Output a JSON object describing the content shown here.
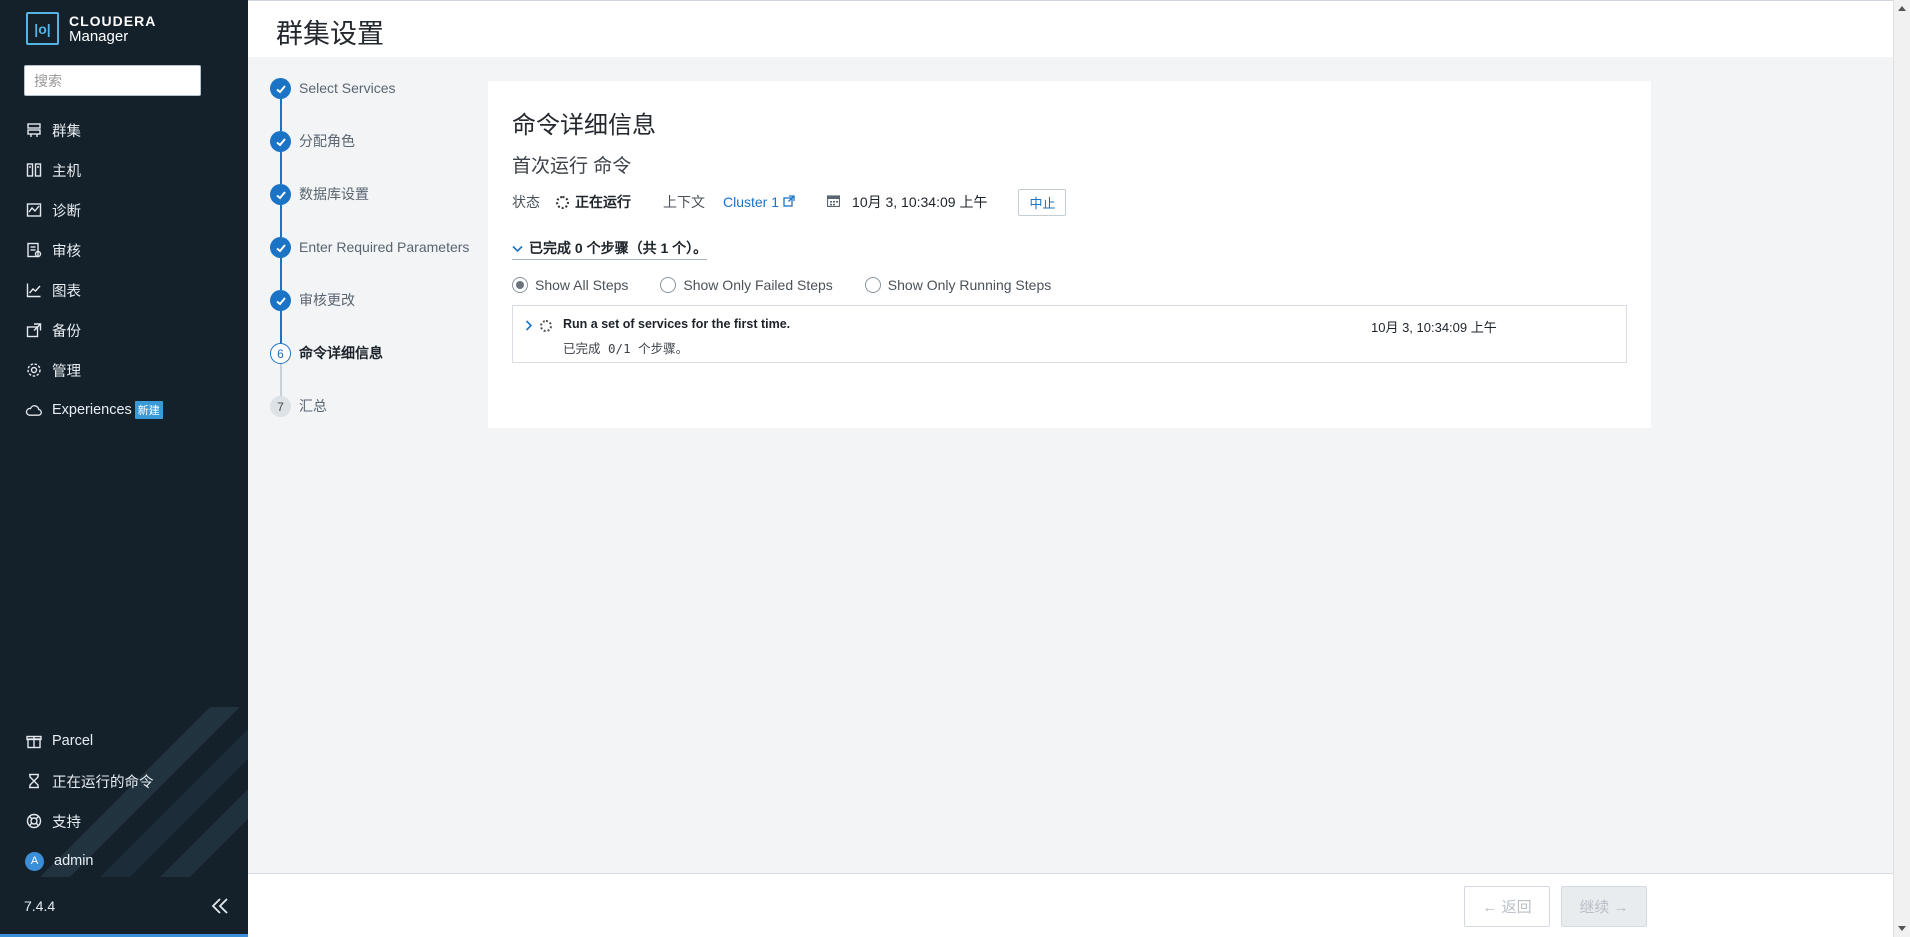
{
  "sidebar": {
    "brand": "CLOUDERA",
    "product": "Manager",
    "search_placeholder": "搜索",
    "nav_items": [
      {
        "label": "群集",
        "icon": "cluster-icon"
      },
      {
        "label": "主机",
        "icon": "host-icon"
      },
      {
        "label": "诊断",
        "icon": "diagnostics-icon"
      },
      {
        "label": "审核",
        "icon": "audit-icon"
      },
      {
        "label": "图表",
        "icon": "chart-icon"
      },
      {
        "label": "备份",
        "icon": "backup-icon"
      },
      {
        "label": "管理",
        "icon": "gear-icon"
      },
      {
        "label": "Experiences",
        "icon": "cloud-icon",
        "badge": "新建"
      }
    ],
    "bottom_items": [
      {
        "label": "Parcel",
        "icon": "parcel-icon"
      },
      {
        "label": "正在运行的命令",
        "icon": "hourglass-icon"
      },
      {
        "label": "支持",
        "icon": "lifebuoy-icon"
      },
      {
        "label": "admin",
        "icon": "avatar",
        "avatar_letter": "A"
      }
    ],
    "version": "7.4.4"
  },
  "header": {
    "title": "群集设置"
  },
  "wizard_steps": [
    {
      "label": "Select Services",
      "state": "done"
    },
    {
      "label": "分配角色",
      "state": "done"
    },
    {
      "label": "数据库设置",
      "state": "done"
    },
    {
      "label": "Enter Required Parameters",
      "state": "done"
    },
    {
      "label": "审核更改",
      "state": "done"
    },
    {
      "label": "命令详细信息",
      "state": "current",
      "number": "6"
    },
    {
      "label": "汇总",
      "state": "todo",
      "number": "7"
    }
  ],
  "command": {
    "title": "命令详细信息",
    "subtitle": "首次运行 命令",
    "status_label": "状态",
    "status_value": "正在运行",
    "context_label": "上下文",
    "context_link": "Cluster 1",
    "timestamp": "10月 3, 10:34:09 上午",
    "abort_label": "中止",
    "summary": "已完成 0 个步骤（共 1 个）。",
    "filters": [
      {
        "label": "Show All Steps",
        "selected": true
      },
      {
        "label": "Show Only Failed Steps",
        "selected": false
      },
      {
        "label": "Show Only Running Steps",
        "selected": false
      }
    ],
    "steps": [
      {
        "title": "Run a set of services for the first time.",
        "subtitle": "已完成 0/1 个步骤。",
        "time": "10月 3, 10:34:09 上午"
      }
    ]
  },
  "footer": {
    "back_label": "← 返回",
    "next_label": "继续 →"
  },
  "colors": {
    "accent": "#1a73c4",
    "sidebar_bg": "#14212b"
  }
}
